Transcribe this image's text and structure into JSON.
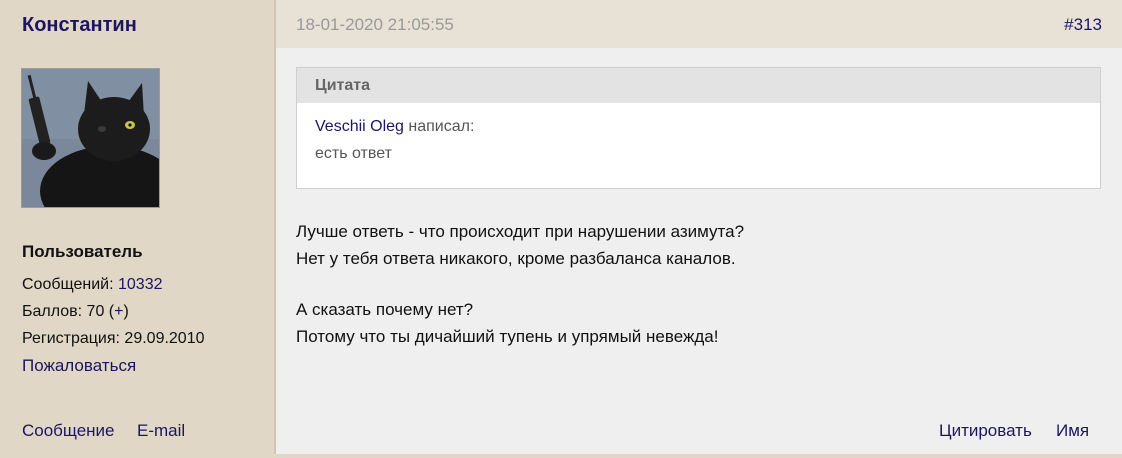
{
  "author": {
    "name": "Константин",
    "rank": "Пользователь",
    "messages_label": "Сообщений: ",
    "messages_count": "10332",
    "points_label": "Баллов: 70 (",
    "points_plus": "+",
    "points_close": ")",
    "registration": "Регистрация: 29.09.2010",
    "report_link": "Пожаловаться",
    "message_link": "Сообщение",
    "email_link": "E-mail"
  },
  "post": {
    "date": "18-01-2020 21:05:55",
    "number": "#313",
    "quote": {
      "title": "Цитата",
      "author": "Veschii Oleg",
      "wrote": " написал:",
      "text": "есть ответ"
    },
    "body": [
      "Лучше ответь - что происходит при нарушении азимута?",
      "Нет у тебя ответа никакого, кроме разбаланса каналов.",
      "А сказать почему нет?",
      "Потому что ты дичайший тупень и упрямый невежда!"
    ],
    "actions": {
      "quote": "Цитировать",
      "name": "Имя"
    }
  },
  "colors": {
    "sidebar_bg": "#e0d7c6",
    "main_bg": "#efefef",
    "link": "#1d1560",
    "muted": "#9a9a9a"
  }
}
